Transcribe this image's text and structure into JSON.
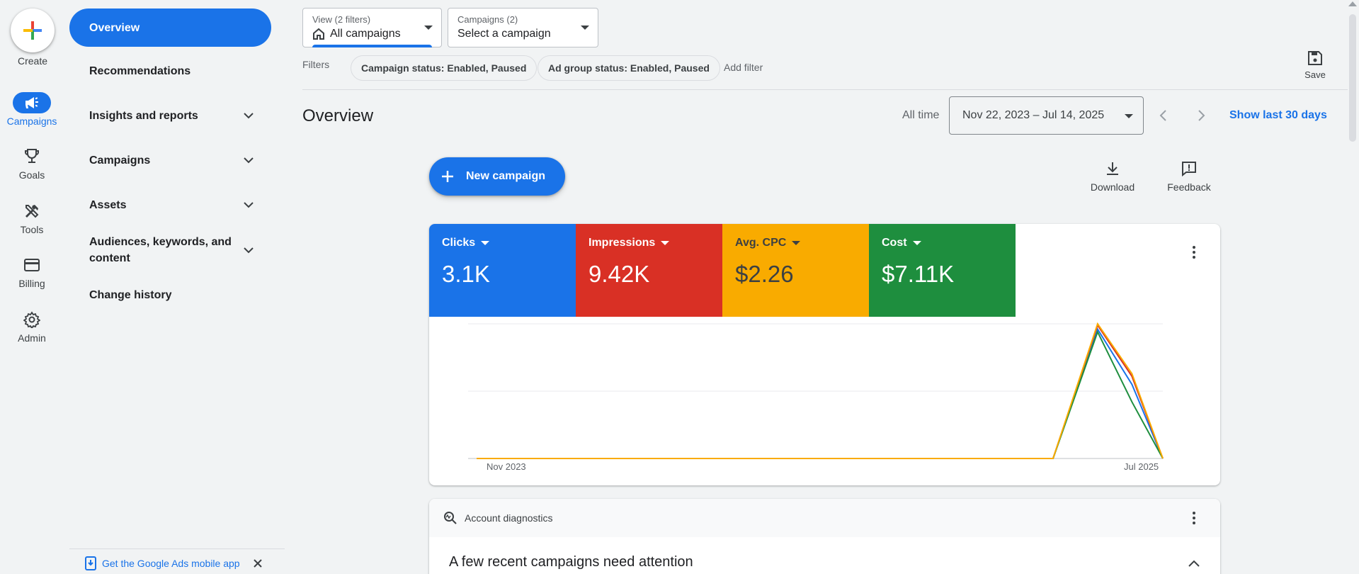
{
  "rail": {
    "create_label": "Create",
    "items": [
      {
        "label": "Campaigns",
        "icon": "megaphone-icon",
        "active": true
      },
      {
        "label": "Goals",
        "icon": "trophy-icon"
      },
      {
        "label": "Tools",
        "icon": "tools-icon"
      },
      {
        "label": "Billing",
        "icon": "credit-card-icon"
      },
      {
        "label": "Admin",
        "icon": "gear-icon"
      }
    ]
  },
  "nav": {
    "items": [
      {
        "label": "Overview",
        "active": true
      },
      {
        "label": "Recommendations"
      },
      {
        "label": "Insights and reports",
        "expandable": true
      },
      {
        "label": "Campaigns",
        "expandable": true
      },
      {
        "label": "Assets",
        "expandable": true
      },
      {
        "label": "Audiences, keywords, and content",
        "expandable": true
      },
      {
        "label": "Change history"
      }
    ],
    "footer_link": "Get the Google Ads mobile app"
  },
  "topbar": {
    "view_small": "View (2 filters)",
    "view_value": "All campaigns",
    "campaigns_small": "Campaigns (2)",
    "campaigns_value": "Select a campaign",
    "filters_label": "Filters",
    "chips": [
      "Campaign status: Enabled, Paused",
      "Ad group status: Enabled, Paused"
    ],
    "add_filter": "Add filter",
    "save_label": "Save"
  },
  "header": {
    "title": "Overview",
    "range_label": "All time",
    "date_range": "Nov 22, 2023 – Jul 14, 2025",
    "last_30": "Show last 30 days"
  },
  "actions": {
    "new_campaign": "New campaign",
    "download": "Download",
    "feedback": "Feedback"
  },
  "colors": {
    "accent": "#1a73e8",
    "clicks": "#1a73e8",
    "impressions": "#d93025",
    "cpc": "#f9ab00",
    "cost": "#1e8e3e"
  },
  "metrics": [
    {
      "name": "Clicks",
      "value": "3.1K",
      "color": "#1a73e8"
    },
    {
      "name": "Impressions",
      "value": "9.42K",
      "color": "#d93025"
    },
    {
      "name": "Avg. CPC",
      "value": "$2.26",
      "color": "#f9ab00"
    },
    {
      "name": "Cost",
      "value": "$7.11K",
      "color": "#1e8e3e"
    }
  ],
  "chart_data": {
    "type": "line",
    "x_start_label": "Nov 2023",
    "x_end_label": "Jul 2025",
    "grid": true,
    "x": [
      0,
      0.84,
      0.905,
      0.955,
      1.0
    ],
    "series": [
      {
        "name": "Clicks",
        "color": "#1a73e8",
        "values": [
          0,
          0,
          0.96,
          0.55,
          0
        ]
      },
      {
        "name": "Impressions",
        "color": "#d93025",
        "values": [
          0,
          0,
          0.99,
          0.61,
          0
        ]
      },
      {
        "name": "Cost",
        "color": "#1e8e3e",
        "values": [
          0,
          0,
          0.94,
          0.42,
          0
        ]
      },
      {
        "name": "Avg. CPC",
        "color": "#f9ab00",
        "values": [
          0,
          0,
          1.0,
          0.63,
          0
        ]
      }
    ]
  },
  "diagnostics": {
    "title": "Account diagnostics",
    "message": "A few recent campaigns need attention"
  }
}
